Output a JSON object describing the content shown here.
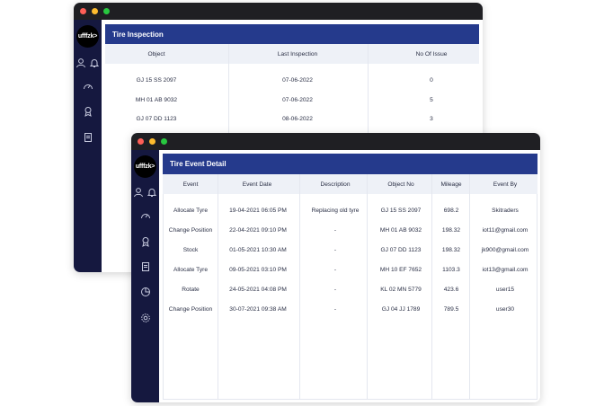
{
  "back_window": {
    "logo_text": "ufffzk>",
    "panel_title": "Tire Inspection",
    "columns": [
      "Object",
      "Last Inspection",
      "No Of Issue"
    ],
    "rows": [
      [
        "GJ 15 SS 2097",
        "07-06-2022",
        "0"
      ],
      [
        "MH 01 AB 9032",
        "07-06-2022",
        "5"
      ],
      [
        "GJ 07 DD 1123",
        "08-06-2022",
        "3"
      ]
    ]
  },
  "front_window": {
    "logo_text": "ufffzk>",
    "panel_title": "Tire Event Detail",
    "columns": [
      "Event",
      "Event Date",
      "Description",
      "Object No",
      "Mileage",
      "Event By"
    ],
    "rows": [
      [
        "Allocate Tyre",
        "19-04-2021 06:05 PM",
        "Replacing old tyre",
        "GJ 15 SS 2097",
        "698.2",
        "Skitraders"
      ],
      [
        "Change Position",
        "22-04-2021 09:10 PM",
        "-",
        "MH 01 AB 9032",
        "198.32",
        "iot11@gmail.com"
      ],
      [
        "Stock",
        "01-05-2021 10:30 AM",
        "-",
        "GJ 07 DD 1123",
        "198.32",
        "jk900@gmail.com"
      ],
      [
        "Allocate Tyre",
        "09-05-2021 03:10 PM",
        "-",
        "MH 10 EF 7652",
        "1103.3",
        "iot13@gmail.com"
      ],
      [
        "Rotate",
        "24-05-2021 04:08 PM",
        "-",
        "KL 02 MN 5779",
        "423.6",
        "user15"
      ],
      [
        "Change Position",
        "30-07-2021 09:38 AM",
        "-",
        "GJ 04 JJ 1789",
        "789.5",
        "user30"
      ]
    ]
  },
  "sidebar_icons": [
    "user-icon",
    "bell-icon",
    "gauge-icon",
    "badge-icon",
    "document-icon",
    "pie-chart-icon",
    "settings-icon"
  ],
  "colors": {
    "titlebar": "#1f1f23",
    "sidebar": "#15183f",
    "panel_header": "#253a8c",
    "table_header": "#eef1f7"
  }
}
